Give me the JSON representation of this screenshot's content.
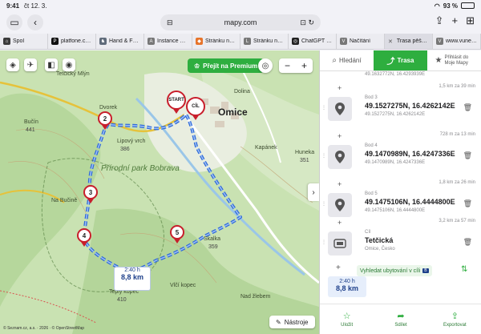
{
  "status": {
    "time": "9:41",
    "date": "čt 12. 3.",
    "battery": "93 %",
    "battery_level": 0.93
  },
  "browser": {
    "url": "mapy.com",
    "tabs": [
      {
        "label": "Spol",
        "color": "#3b3b3b",
        "glyph": "⌂"
      },
      {
        "label": "platfone.com",
        "color": "#111111",
        "glyph": "P"
      },
      {
        "label": "Hand & Foot...",
        "color": "#5f6b7a",
        "glyph": "♞"
      },
      {
        "label": "Instance det...",
        "color": "#777777",
        "glyph": "A"
      },
      {
        "label": "Stránku nelz...",
        "color": "#e7742a",
        "glyph": "◆"
      },
      {
        "label": "Stránku nelz...",
        "color": "#777777",
        "glyph": "L"
      },
      {
        "label": "ChatGPT čes...",
        "color": "#222222",
        "glyph": "◎"
      },
      {
        "label": "Načítání",
        "color": "#777777",
        "glyph": "V"
      },
      {
        "label": "Trasa pěšky:...",
        "color": "#999999",
        "glyph": "×",
        "active": true
      },
      {
        "label": "www.vune.in...",
        "color": "#777777",
        "glyph": "V"
      }
    ]
  },
  "map": {
    "premium_label": "Přejít na Premium",
    "zoom_minus": "−",
    "zoom_plus": "+",
    "tools_label": "Nástroje",
    "copyright": "© Seznam.cz, a.s. · 2026 · © OpenStreetMap",
    "labels": {
      "town": "Omice",
      "park": "Přírodní park Bobrava",
      "tetcicky_mlyn": "Tetčický Mlýn",
      "dvorek": "Dvorek",
      "lipovy_vrch": "Lipový vrch",
      "lipovy_num": "386",
      "bucin": "Bučín",
      "bucin_num": "441",
      "na_bucine": "Na Bučině",
      "skalka": "Skalka",
      "skalka_num": "359",
      "vlci_kopec": "Vlčí kopec",
      "teply_kopec": "Teplý kopec",
      "teply_num": "410",
      "kapanek": "Kapánek",
      "hunek": "Huneka",
      "hunek_num": "351",
      "nad_zlebem": "Nad žlebem",
      "dolina": "Dolina"
    },
    "markers": [
      {
        "label": "2"
      },
      {
        "label": "3"
      },
      {
        "label": "4"
      },
      {
        "label": "5"
      },
      {
        "label": "START"
      },
      {
        "label": "CÍL"
      }
    ],
    "summary": {
      "time": "2:40 h",
      "distance": "8,8 km"
    }
  },
  "panel": {
    "tabs": {
      "search": "Hledání",
      "route": "Trasa",
      "login": "Přihlásit do Moje Mapy"
    },
    "top_coord": "49.1632772N, 16.4293939E",
    "segments": [
      "1,5 km za 39 min",
      "728 m za 13 min",
      "1,8 km za 26 min",
      "3,2 km za 57 min"
    ],
    "waypoints": [
      {
        "label": "Bod 3",
        "main": "49.1527275N, 16.4262142E",
        "sub": "49.1527275N, 16.4262142E"
      },
      {
        "label": "Bod 4",
        "main": "49.1470989N, 16.4247336E",
        "sub": "49.1470989N, 16.4247336E"
      },
      {
        "label": "Bod 5",
        "main": "49.1475106N, 16.4444800E",
        "sub": "49.1475106N, 16.4444800E"
      },
      {
        "label": "Cíl",
        "main": "Tetčická",
        "sub": "Omice, Česko"
      }
    ],
    "hotel": "Vyhledat ubytování v cíli",
    "summary": {
      "time": "2:40 h",
      "distance": "8,8 km"
    },
    "actions": {
      "save": "Uložit",
      "share": "Sdílet",
      "export": "Exportovat"
    }
  }
}
